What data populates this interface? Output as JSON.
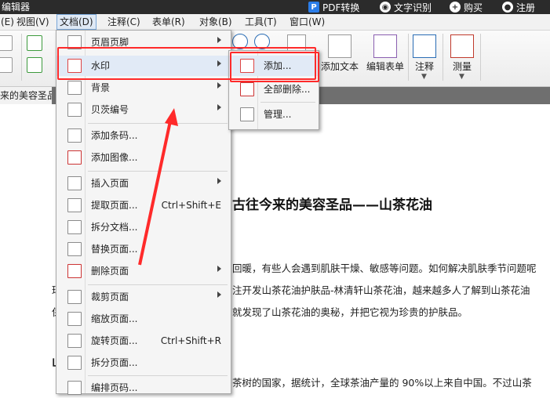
{
  "titlebar": {
    "app_title": "编辑器",
    "actions": [
      {
        "label": "PDF转换",
        "icon": "pdf-convert-icon"
      },
      {
        "label": "文字识别",
        "icon": "eye-icon"
      },
      {
        "label": "购买",
        "icon": "plus-icon"
      },
      {
        "label": "注册",
        "icon": "user-icon"
      }
    ]
  },
  "menubar": {
    "items": [
      "(E)",
      "视图(V)",
      "文档(D)",
      "注释(C)",
      "表单(R)",
      "对象(B)",
      "工具(T)",
      "窗口(W)"
    ],
    "active": "文档(D)"
  },
  "toolbar": {
    "add_text_label": "添加文本",
    "edit_form_label": "编辑表单",
    "comment_label": "注释",
    "measure_label": "测量"
  },
  "tab": {
    "label": "来的美容圣品-"
  },
  "document": {
    "title": "古往今来的美容圣品——山茶花油",
    "lines": [
      "回暖，有些人会遇到肌肤干燥、敏感等问题。如何解决肌肤季节问题呢",
      "注开发山茶花油护肤品-林清轩山茶花油，越来越多人了解到山茶花油",
      "就发现了山茶花油的奥秘，并把它视为珍贵的护肤品。",
      "茶树的国家，据统计，全球茶油产量的 90%以上来自中国。不过山茶"
    ],
    "left_chars": [
      "珥",
      "保",
      "山"
    ]
  },
  "doc_menu": {
    "items": [
      {
        "label": "页眉页脚",
        "icon": "header-footer-icon",
        "submenu": true,
        "shortcut": ""
      },
      {
        "label": "水印",
        "icon": "watermark-icon",
        "submenu": true,
        "shortcut": ""
      },
      {
        "label": "背景",
        "icon": "background-icon",
        "submenu": true,
        "shortcut": ""
      },
      {
        "label": "贝茨编号",
        "icon": "bates-number-icon",
        "submenu": true,
        "shortcut": ""
      },
      {
        "label": "添加条码...",
        "icon": "barcode-icon",
        "submenu": false,
        "shortcut": ""
      },
      {
        "label": "添加图像...",
        "icon": "add-image-icon",
        "submenu": false,
        "shortcut": ""
      },
      {
        "label": "插入页面",
        "icon": "insert-page-icon",
        "submenu": true,
        "shortcut": ""
      },
      {
        "label": "提取页面...",
        "icon": "extract-page-icon",
        "submenu": false,
        "shortcut": "Ctrl+Shift+E"
      },
      {
        "label": "拆分文档...",
        "icon": "split-doc-icon",
        "submenu": false,
        "shortcut": ""
      },
      {
        "label": "替换页面...",
        "icon": "replace-page-icon",
        "submenu": false,
        "shortcut": ""
      },
      {
        "label": "删除页面",
        "icon": "delete-page-icon",
        "submenu": true,
        "shortcut": ""
      },
      {
        "label": "裁剪页面",
        "icon": "crop-page-icon",
        "submenu": true,
        "shortcut": ""
      },
      {
        "label": "缩放页面...",
        "icon": "resize-page-icon",
        "submenu": false,
        "shortcut": ""
      },
      {
        "label": "旋转页面...",
        "icon": "rotate-page-icon",
        "submenu": false,
        "shortcut": "Ctrl+Shift+R"
      },
      {
        "label": "拆分页面...",
        "icon": "split-page-icon",
        "submenu": false,
        "shortcut": ""
      },
      {
        "label": "编排页码...",
        "icon": "page-number-icon",
        "submenu": false,
        "shortcut": ""
      }
    ]
  },
  "watermark_menu": {
    "items": [
      {
        "label": "添加...",
        "icon": "watermark-add-icon"
      },
      {
        "label": "全部删除...",
        "icon": "watermark-delete-icon"
      },
      {
        "label": "管理...",
        "icon": "watermark-manage-icon"
      }
    ]
  },
  "colors": {
    "highlight_red": "#ff2a2a",
    "menu_hover": "#e1eaf6",
    "titlebar": "#2b2b2b"
  }
}
